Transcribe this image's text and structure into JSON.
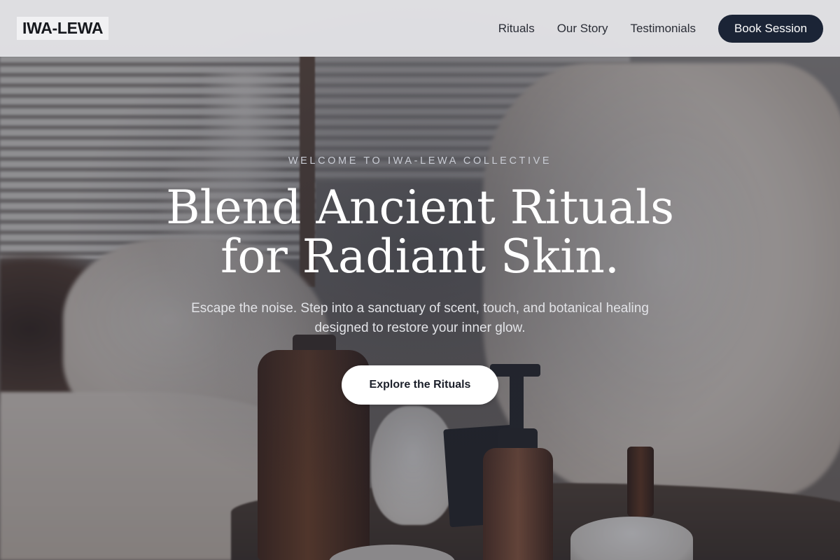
{
  "header": {
    "logo": "IWA-LEWA",
    "nav_links": [
      {
        "label": "Rituals"
      },
      {
        "label": "Our Story"
      },
      {
        "label": "Testimonials"
      }
    ],
    "cta_label": "Book Session"
  },
  "hero": {
    "eyebrow": "WELCOME TO IWA-LEWA COLLECTIVE",
    "headline_line1": "Blend Ancient Rituals",
    "headline_line2": "for Radiant Skin.",
    "subtext": "Escape the noise. Step into a sanctuary of scent, touch, and botanical healing designed to restore your inner glow.",
    "cta_label": "Explore the Rituals"
  },
  "colors": {
    "nav_background": "#e8e8eb",
    "primary_button": "#1b2436",
    "overlay": "#2a3040"
  }
}
